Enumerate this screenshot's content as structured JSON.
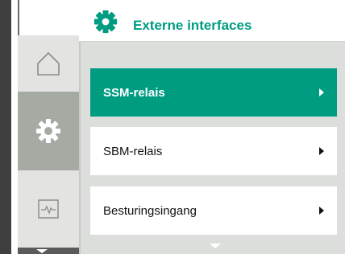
{
  "header": {
    "title": "Externe interfaces",
    "icon": "gear-icon",
    "accent_color": "#009c82"
  },
  "sidebar": {
    "items": [
      {
        "name": "home",
        "icon": "home-icon",
        "selected": false
      },
      {
        "name": "settings",
        "icon": "gear-icon",
        "selected": true
      },
      {
        "name": "diagnostics",
        "icon": "monitor-icon",
        "selected": false
      }
    ]
  },
  "menu": {
    "items": [
      {
        "label": "SSM-relais",
        "selected": true
      },
      {
        "label": "SBM-relais",
        "selected": false
      },
      {
        "label": "Besturingsingang",
        "selected": false
      }
    ]
  }
}
